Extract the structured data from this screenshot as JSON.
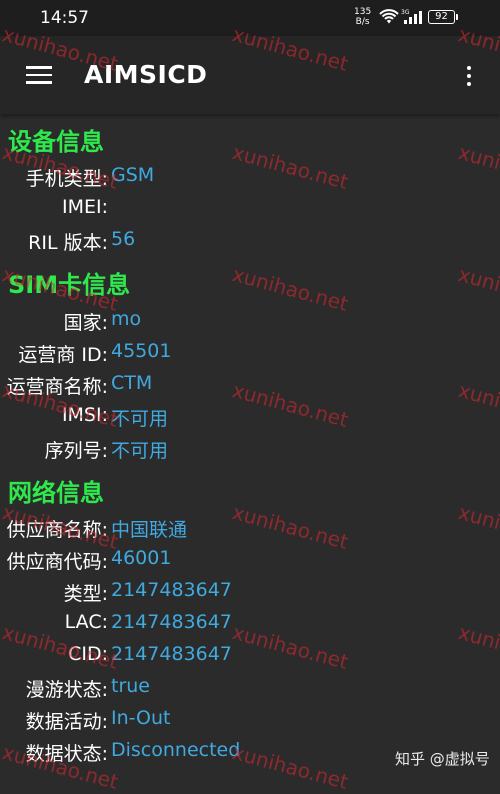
{
  "status_bar": {
    "time": "14:57",
    "net_speed_value": "135",
    "net_speed_unit": "B/s",
    "battery": "92",
    "wifi_icon": "wifi-icon",
    "signal_icon": "signal-icon"
  },
  "app_bar": {
    "title": "AIMSICD",
    "menu_icon": "menu-icon",
    "overflow_icon": "overflow-icon"
  },
  "sections": {
    "device": {
      "title": "设备信息",
      "rows": [
        {
          "label": "手机类型:",
          "value": "GSM"
        },
        {
          "label": "IMEI:",
          "value": ""
        },
        {
          "label": "RIL 版本:",
          "value": "56"
        }
      ]
    },
    "sim": {
      "title": "SIM卡信息",
      "rows": [
        {
          "label": "国家:",
          "value": "mo"
        },
        {
          "label": "运营商 ID:",
          "value": "45501"
        },
        {
          "label": "运营商名称:",
          "value": "CTM"
        },
        {
          "label": "IMSI:",
          "value": "不可用"
        },
        {
          "label": "序列号:",
          "value": "不可用"
        }
      ]
    },
    "network": {
      "title": "网络信息",
      "rows": [
        {
          "label": "供应商名称:",
          "value": "中国联通"
        },
        {
          "label": "供应商代码:",
          "value": "46001"
        },
        {
          "label": "类型:",
          "value": "2147483647"
        },
        {
          "label": "LAC:",
          "value": "2147483647"
        },
        {
          "label": "CID:",
          "value": "2147483647"
        },
        {
          "label": "漫游状态:",
          "value": "true"
        },
        {
          "label": "数据活动:",
          "value": "In-Out"
        },
        {
          "label": "数据状态:",
          "value": "Disconnected"
        }
      ]
    }
  },
  "watermark": {
    "text": "xunihao.net"
  },
  "credit": "知乎 @虚拟号",
  "colors": {
    "background": "#2b2b2b",
    "app_bar": "#262626",
    "section_header": "#2ee84c",
    "value": "#3fa9e0",
    "label": "#ffffff",
    "watermark": "#dc2832"
  }
}
